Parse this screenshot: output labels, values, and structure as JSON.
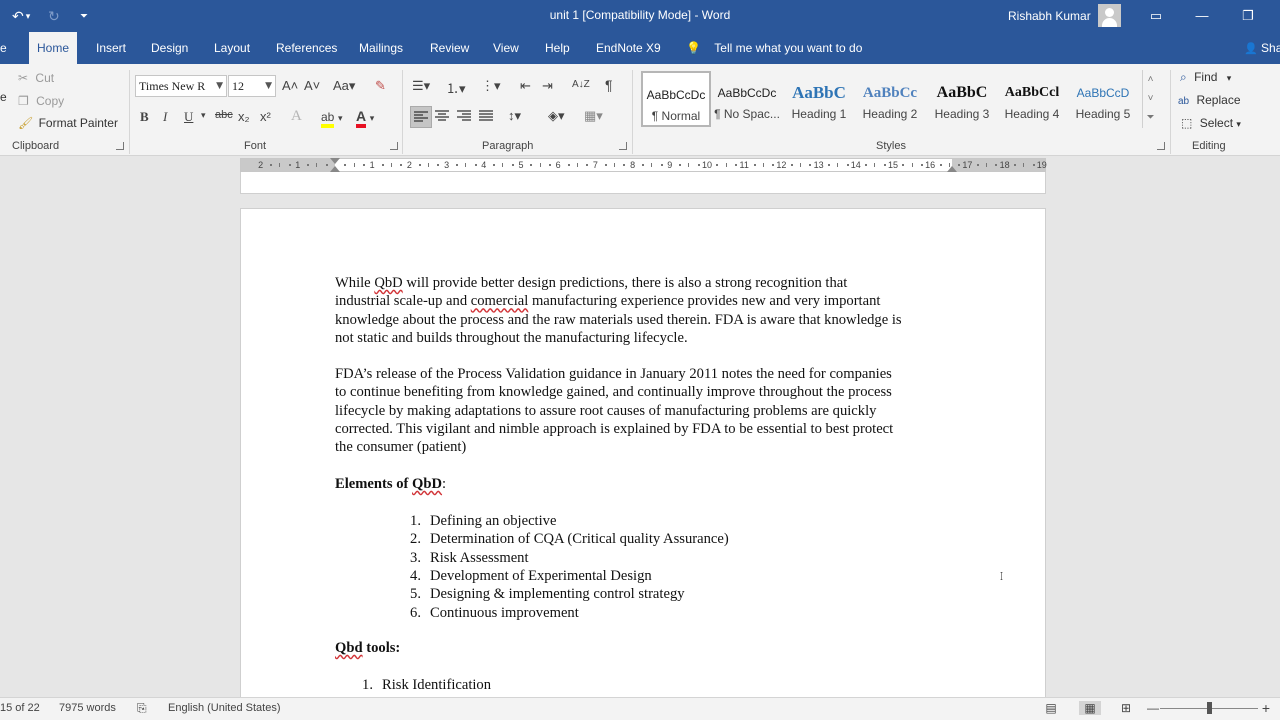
{
  "titlebar": {
    "document_title": "unit 1 [Compatibility Mode]  -  Word",
    "user_name": "Rishabh Kumar",
    "undo_icon": "undo-icon",
    "redo_icon": "redo-icon",
    "customize_icon": "customize-quick-access-icon",
    "ribbon_options_glyph": "▭",
    "minimize_glyph": "—",
    "restore_glyph": "❐",
    "undo_glyph": "↶",
    "redo_glyph": "↻",
    "dropdown_glyph": "▾",
    "customize_glyph": "⏷"
  },
  "tabs": {
    "file_partial": "e",
    "items": [
      "Home",
      "Insert",
      "Design",
      "Layout",
      "References",
      "Mailings",
      "Review",
      "View",
      "Help",
      "EndNote X9"
    ],
    "active": "Home",
    "tell_me": "Tell me what you want to do",
    "tell_me_icon": "lightbulb-icon",
    "share_partial": "Sha",
    "share_icon": "person-icon",
    "bulb_glyph": "💡",
    "person_glyph": "👤"
  },
  "clipboard": {
    "cut": "Cut",
    "copy": "Copy",
    "format_painter": "Format Painter",
    "label": "Clipboard",
    "paste_partial": "e",
    "cut_glyph": "✂",
    "copy_glyph": "❐",
    "brush_glyph": "🖌"
  },
  "font": {
    "font_name": "Times New R",
    "font_size": "12",
    "label": "Font",
    "grow_glyph": "A˄",
    "shrink_glyph": "A˅",
    "case_glyph": "Aa▾",
    "clear_glyph": "✎",
    "bold": "B",
    "italic": "I",
    "underline": "U",
    "strike": "abc",
    "subscript": "x₂",
    "superscript": "x²",
    "effects_glyph": "A",
    "highlight_glyph": "ab",
    "font_color_glyph": "A",
    "highlight_color": "#ffff00",
    "font_color": "#e81123"
  },
  "paragraph": {
    "label": "Paragraph",
    "show_marks_glyph": "¶",
    "sort_glyph": "A↓Z",
    "bullets_glyph": "☰▾",
    "numbering_glyph": "⒈▾",
    "multilevel_glyph": "⋮▾",
    "decrease_indent_glyph": "⇤",
    "increase_indent_glyph": "⇥",
    "line_spacing_glyph": "↕▾",
    "shading_glyph": "◈▾",
    "borders_glyph": "▦▾"
  },
  "styles": {
    "label": "Styles",
    "items": [
      {
        "sample": "AaBbCcDc",
        "name": "¶ Normal"
      },
      {
        "sample": "AaBbCcDc",
        "name": "¶ No Spac..."
      },
      {
        "sample": "AaBbC",
        "name": "Heading 1"
      },
      {
        "sample": "AaBbCc",
        "name": "Heading 2"
      },
      {
        "sample": "AaBbC",
        "name": "Heading 3"
      },
      {
        "sample": "AaBbCcl",
        "name": "Heading 4"
      },
      {
        "sample": "AaBbCcD",
        "name": "Heading 5"
      }
    ],
    "heading_color": "#2e74b5",
    "scroll_up_glyph": "˄",
    "scroll_down_glyph": "˅",
    "more_glyph": "⏷"
  },
  "editing": {
    "label": "Editing",
    "find": "Find",
    "replace": "Replace",
    "select": "Select",
    "find_glyph": "⌕",
    "replace_glyph": "ab",
    "select_glyph": "⬚"
  },
  "ruler": {
    "numbers": [
      "2",
      "1",
      "",
      "1",
      "2",
      "3",
      "4",
      "5",
      "6",
      "7",
      "8",
      "9",
      "10",
      "11",
      "12",
      "13",
      "14",
      "15",
      "16",
      "17",
      "18",
      "19"
    ]
  },
  "document": {
    "para1": [
      {
        "pre": "While ",
        "sq": "QbD",
        "post": " will provide better design predictions, there is also a strong recognition that"
      },
      {
        "pre": "industrial scale-up and ",
        "sq": "comercial",
        "post": " manufacturing experience provides new and very important"
      },
      {
        "pre": "knowledge about the process and the raw materials used therein. FDA is aware that knowledge is",
        "sq": "",
        "post": ""
      },
      {
        "pre": "not static and builds throughout the manufacturing lifecycle.",
        "sq": "",
        "post": ""
      }
    ],
    "para2": [
      "FDA’s release of the Process Validation guidance in January 2011 notes the need for companies",
      "to continue benefiting from knowledge gained, and continually improve throughout the process",
      "lifecycle by making adaptations to assure root causes of manufacturing problems are quickly",
      "corrected. This vigilant and nimble approach is explained by FDA to be essential to best protect",
      "the consumer (patient)"
    ],
    "heading1_pre": "Elements of ",
    "heading1_sq": "QbD",
    "heading1_post": ":",
    "elements": [
      {
        "n": "1.",
        "text": "Defining an objective"
      },
      {
        "n": "2.",
        "text": "Determination of CQA (Critical quality Assurance)"
      },
      {
        "n": "3.",
        "text": "Risk Assessment"
      },
      {
        "n": "4.",
        "text": "Development of Experimental Design"
      },
      {
        "n": "5.",
        "text": "Designing & implementing control strategy"
      },
      {
        "n": "6.",
        "text": "Continuous improvement"
      }
    ],
    "heading2_sq": "Qbd",
    "heading2_post": " tools:",
    "tools": [
      {
        "n": "1.",
        "text": "Risk Identification"
      }
    ]
  },
  "statusbar": {
    "page": "15 of 22",
    "words": "7975 words",
    "language": "English (United States)",
    "proofing_icon": "proofing-icon",
    "proofing_glyph": "⎘",
    "read_mode_glyph": "▤",
    "print_layout_glyph": "▦",
    "web_layout_glyph": "⊞",
    "zoom_out": "—",
    "zoom_in": "+",
    "zoom_level": 0.5
  }
}
